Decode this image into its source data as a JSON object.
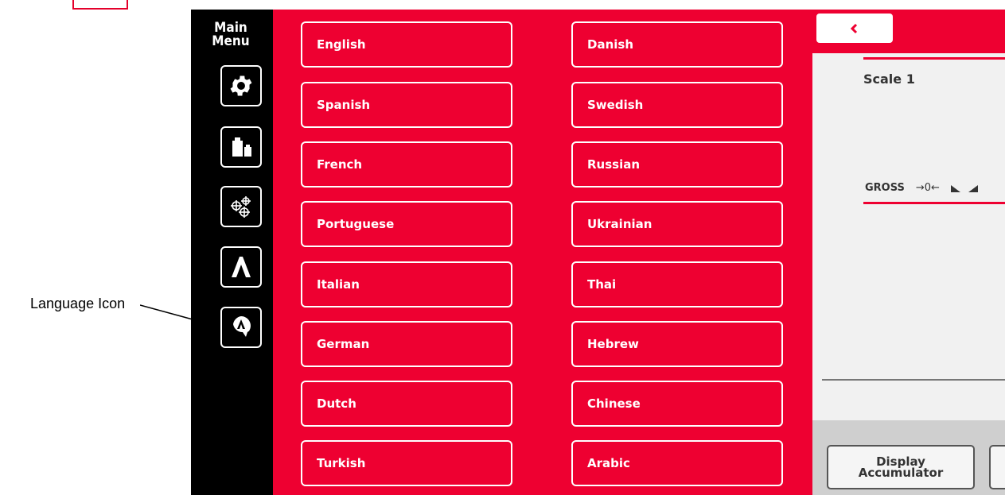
{
  "annotation": {
    "label": "Language Icon"
  },
  "sidebar": {
    "title": "Main\nMenu",
    "buttons": [
      {
        "icon": "gear-icon"
      },
      {
        "icon": "weights-icon"
      },
      {
        "icon": "calibration-targets-icon"
      },
      {
        "icon": "tilt-icon"
      },
      {
        "icon": "language-icon"
      }
    ]
  },
  "languages": {
    "left": [
      "English",
      "Spanish",
      "French",
      "Portuguese",
      "Italian",
      "German",
      "Dutch",
      "Turkish"
    ],
    "right": [
      "Danish",
      "Swedish",
      "Russian",
      "Ukrainian",
      "Thai",
      "Hebrew",
      "Chinese",
      "Arabic"
    ]
  },
  "scale_panel": {
    "back_icon": "chevron-left-icon",
    "title": "Scale 1",
    "gross_label": "GROSS",
    "center_zero_symbol": "→0←",
    "footer_button_1": "Display\nAccumulator"
  },
  "colors": {
    "brand_red": "#ee0031",
    "sidebar_black": "#000000",
    "panel_gray": "#f1f1f1"
  }
}
